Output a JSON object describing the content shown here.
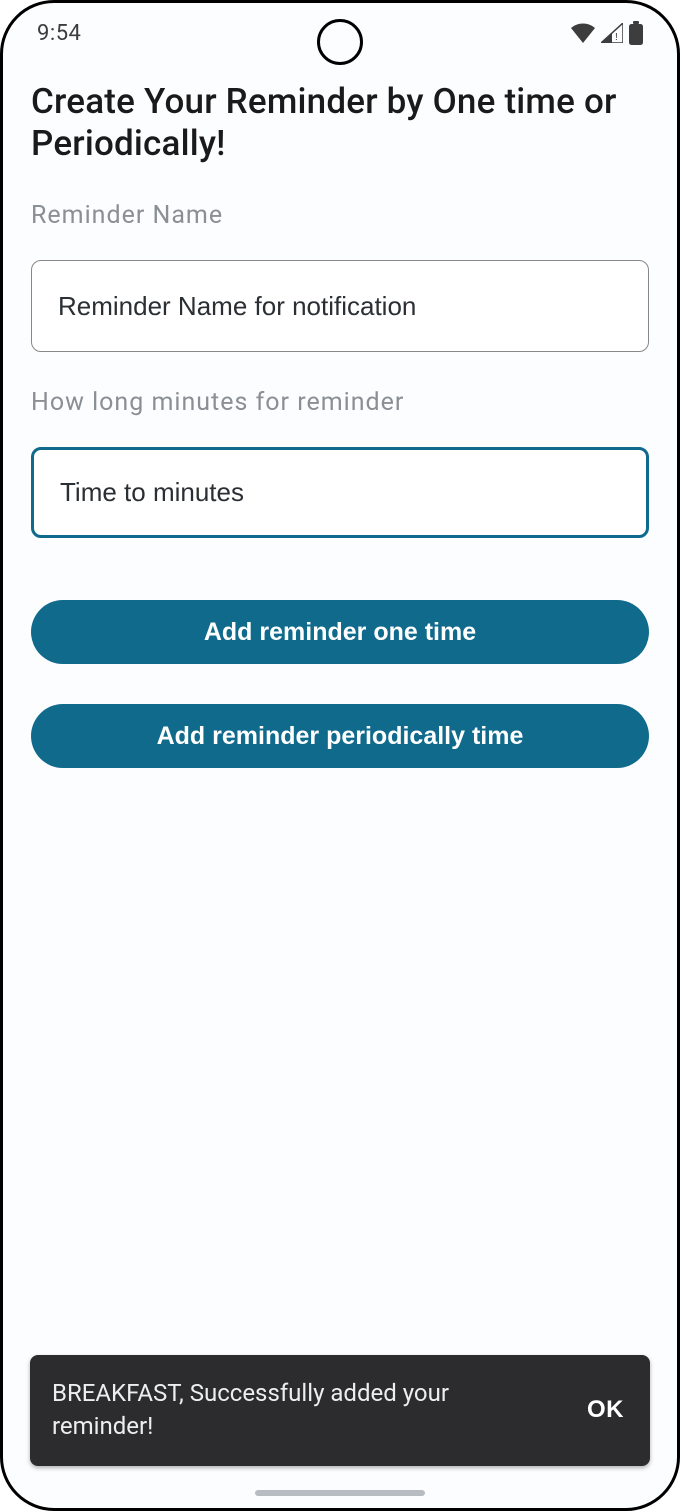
{
  "status": {
    "time": "9:54"
  },
  "colors": {
    "accent": "#0f6a8c",
    "snackbar_bg": "#2c2c2e"
  },
  "page": {
    "title": "Create Your Reminder by One time or Periodically!"
  },
  "fields": {
    "name": {
      "label": "Reminder Name",
      "placeholder": "Reminder Name for notification",
      "value": ""
    },
    "minutes": {
      "label": "How long minutes for reminder",
      "placeholder": "Time to minutes",
      "value": ""
    }
  },
  "buttons": {
    "one_time": "Add reminder one time",
    "periodic": "Add reminder periodically time"
  },
  "snackbar": {
    "message": "BREAKFAST, Successfully added your reminder!",
    "action": "OK"
  }
}
